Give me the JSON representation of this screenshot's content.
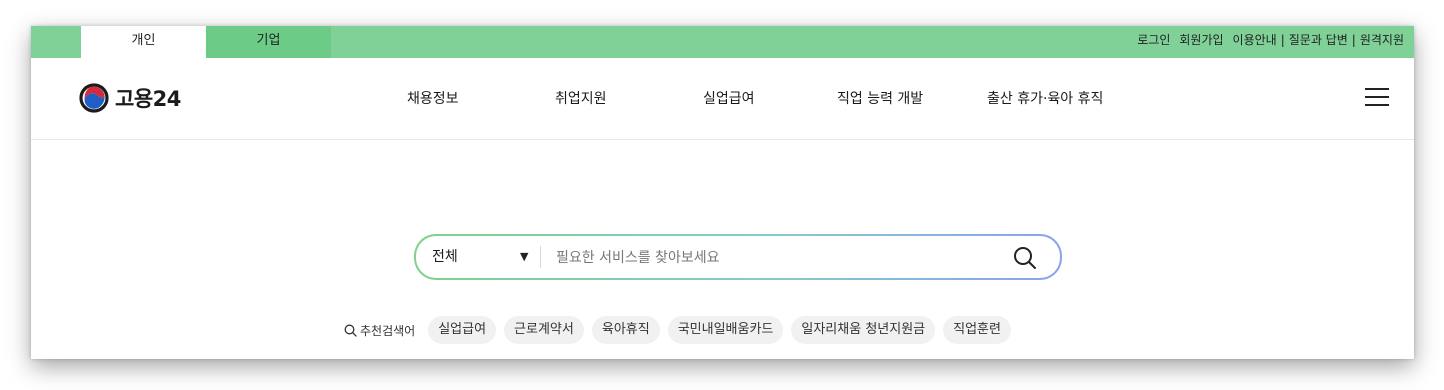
{
  "top_bar": {
    "tabs": [
      {
        "label": "개인",
        "active": true
      },
      {
        "label": "기업",
        "active": false
      }
    ],
    "links": {
      "login": "로그인",
      "signup": "회원가입",
      "guide": "이용안내",
      "separator": "|",
      "qna": "질문과 답변",
      "remote": "원격지원"
    },
    "colors": {
      "bar": "#7fd197",
      "inactive_tab": "#6ccb87"
    }
  },
  "header": {
    "logo_text": "고용24",
    "logo_icon": "taegeuk-logo-icon",
    "nav": [
      {
        "label": "채용정보"
      },
      {
        "label": "취업지원"
      },
      {
        "label": "실업급여"
      },
      {
        "label": "직업 능력 개발"
      },
      {
        "label": "출산 휴가·육아 휴직"
      }
    ],
    "menu_icon": "hamburger-menu-icon"
  },
  "search": {
    "scope_selected": "전체",
    "scope_caret": "▼",
    "placeholder": "필요한 서비스를 찾아보세요",
    "value": "",
    "button_icon": "search-icon",
    "border_gradient": [
      "#7fd18c",
      "#8aa2f0"
    ]
  },
  "recommended": {
    "label": "추천검색어",
    "keywords": [
      "실업급여",
      "근로계약서",
      "육아휴직",
      "국민내일배움카드",
      "일자리채움 청년지원금",
      "직업훈련"
    ]
  }
}
